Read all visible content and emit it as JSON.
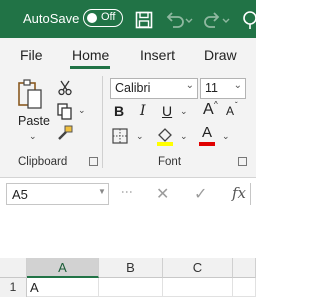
{
  "titlebar": {
    "autosave_label": "AutoSave",
    "autosave_state": "Off",
    "icons": [
      "save-icon",
      "undo-icon",
      "redo-icon"
    ]
  },
  "tabs": [
    {
      "label": "File"
    },
    {
      "label": "Home",
      "active": true
    },
    {
      "label": "Insert"
    },
    {
      "label": "Draw"
    }
  ],
  "ribbon": {
    "clipboard": {
      "paste_label": "Paste",
      "group_label": "Clipboard"
    },
    "font": {
      "font_name": "Calibri",
      "font_size": "11",
      "bold": "B",
      "italic": "I",
      "underline": "U",
      "grow": "A",
      "shrink": "A",
      "font_color": "A",
      "group_label": "Font"
    }
  },
  "formula_bar": {
    "name_box": "A5",
    "fx_label": "fx"
  },
  "sheet": {
    "columns": [
      "A",
      "B",
      "C"
    ],
    "rows": [
      {
        "row": "1",
        "cells": [
          "A",
          "",
          ""
        ]
      }
    ]
  },
  "colors": {
    "accent": "#217346",
    "fill_highlight": "#ffff00",
    "font_color_bar": "#e00000"
  }
}
